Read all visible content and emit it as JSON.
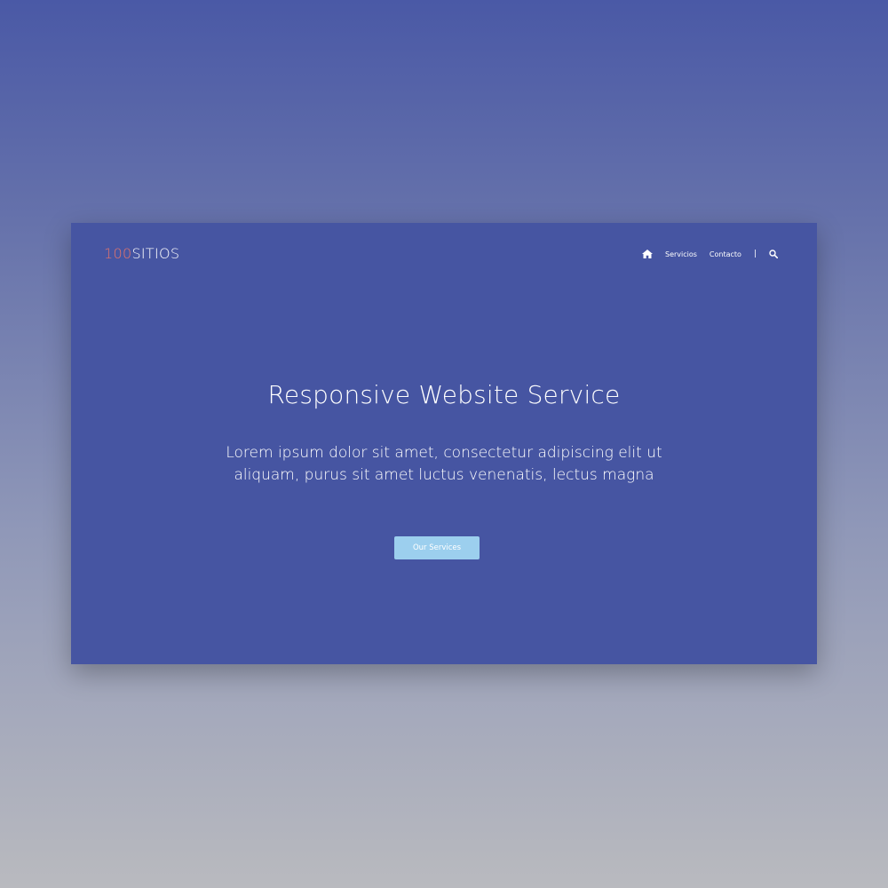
{
  "brand": {
    "logo_number": "100",
    "logo_word": "SITIOS"
  },
  "nav": {
    "home_icon": "home-icon",
    "items": [
      {
        "label": "Servicios"
      },
      {
        "label": "Contacto"
      }
    ],
    "separator": "|",
    "search_icon": "search-icon"
  },
  "hero": {
    "title": "Responsive Website Service",
    "text": "Lorem ipsum dolor sit amet, consectetur adipiscing elit ut aliquam, purus sit amet luctus venenatis, lectus magna",
    "cta_label": "Our Services"
  },
  "colors": {
    "card_bg": "#4655a2",
    "logo_accent": "#e3746c",
    "cta_bg": "#9ccfee",
    "text": "#ffffff"
  }
}
